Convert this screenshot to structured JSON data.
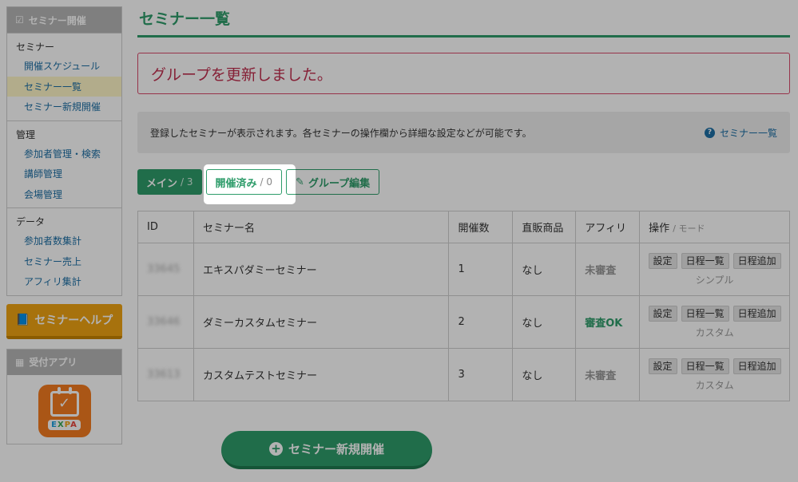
{
  "sidebar": {
    "header": "セミナー開催",
    "sections": [
      {
        "title": "セミナー",
        "items": [
          "開催スケジュール",
          "セミナー一覧",
          "セミナー新規開催"
        ]
      },
      {
        "title": "管理",
        "items": [
          "参加者管理・検索",
          "講師管理",
          "会場管理"
        ]
      },
      {
        "title": "データ",
        "items": [
          "参加者数集計",
          "セミナー売上",
          "アフィリ集計"
        ]
      }
    ],
    "help_button": "セミナーヘルプ",
    "app_header": "受付アプリ",
    "app_brand": [
      "E",
      "X",
      "P",
      "A"
    ]
  },
  "main": {
    "title": "セミナー一覧",
    "alert": "グループを更新しました。",
    "info": "登録したセミナーが表示されます。各セミナーの操作欄から詳細な設定などが可能です。",
    "info_link": "セミナー一覧",
    "tabs": {
      "main_label": "メイン",
      "main_count": "/ 3",
      "done_label": "開催済み",
      "done_count": "/ 0",
      "group_edit": "グループ編集"
    },
    "table": {
      "headers": [
        "ID",
        "セミナー名",
        "開催数",
        "直販商品",
        "アフィリ",
        "操作"
      ],
      "mode_label": "/ モード",
      "rows": [
        {
          "id": "33645",
          "name": "エキスパダミーセミナー",
          "count": "1",
          "product": "なし",
          "affiliate": "未審査",
          "mode": "シンプル"
        },
        {
          "id": "33646",
          "name": "ダミーカスタムセミナー",
          "count": "2",
          "product": "なし",
          "affiliate": "審査OK",
          "mode": "カスタム"
        },
        {
          "id": "33613",
          "name": "カスタムテストセミナー",
          "count": "3",
          "product": "なし",
          "affiliate": "未審査",
          "mode": "カスタム"
        }
      ],
      "op_buttons": [
        "設定",
        "日程一覧",
        "日程追加"
      ]
    },
    "new_button": "セミナー新規開催"
  }
}
